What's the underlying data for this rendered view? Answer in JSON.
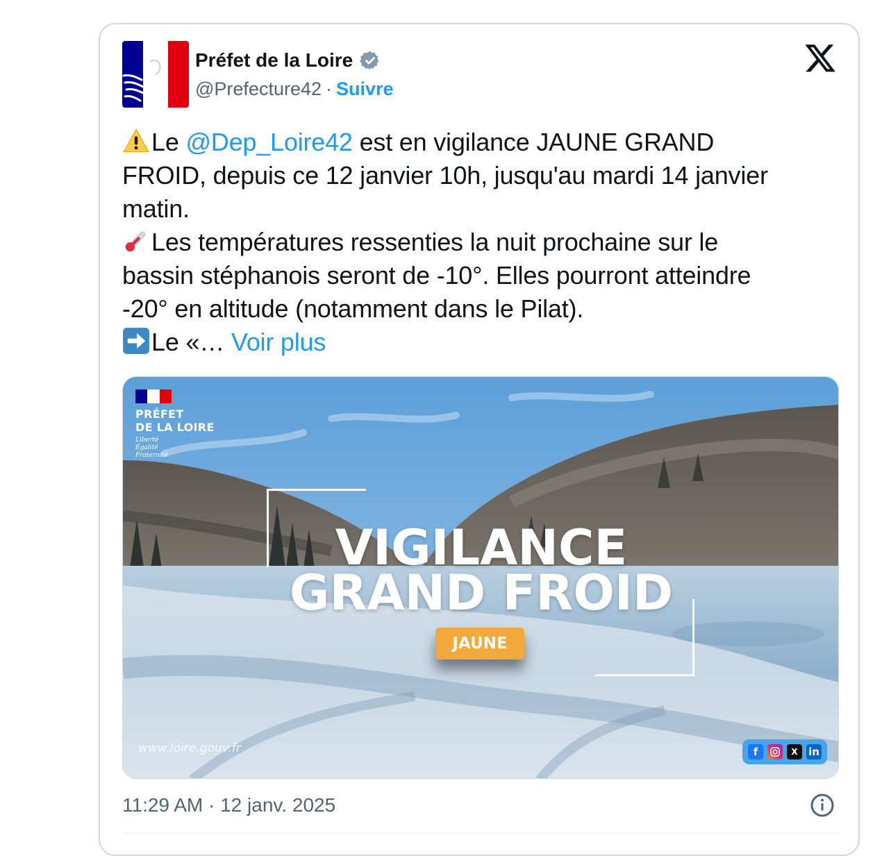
{
  "account": {
    "name": "Préfet de la Loire",
    "handle": "@Prefecture42",
    "separator": "·",
    "follow_label": "Suivre",
    "verified_icon": "verified-badge-icon"
  },
  "tweet": {
    "line1_prefix": "Le ",
    "line1_mention": "@Dep_Loire42",
    "line1_suffix": " est en vigilance JAUNE GRAND",
    "line2": "FROID, depuis ce 12 janvier 10h, jusqu'au mardi 14 janvier",
    "line3": "matin.",
    "line4": "Les températures ressenties la nuit prochaine sur le",
    "line5": "bassin stéphanois seront de -10°. Elles pourront atteindre",
    "line6": "-20° en altitude (notamment dans le Pilat).",
    "line7_prefix": "Le «… ",
    "more_label": "Voir plus"
  },
  "media": {
    "prefet_line1": "PRÉFET",
    "prefet_line2": "DE LA LOIRE",
    "motto1": "Liberté",
    "motto2": "Égalité",
    "motto3": "Fraternité",
    "title1": "VIGILANCE",
    "title2": "GRAND FROID",
    "level": "JAUNE",
    "level_color": "#f2a93b",
    "site": "www.loire.gouv.fr",
    "socials": [
      "facebook-icon",
      "instagram-icon",
      "x-icon",
      "linkedin-icon"
    ]
  },
  "footer": {
    "timestamp": "11:29 AM · 12 janv. 2025"
  },
  "colors": {
    "link": "#1d9bf0",
    "muted": "#536471",
    "border": "#cfd9de"
  }
}
